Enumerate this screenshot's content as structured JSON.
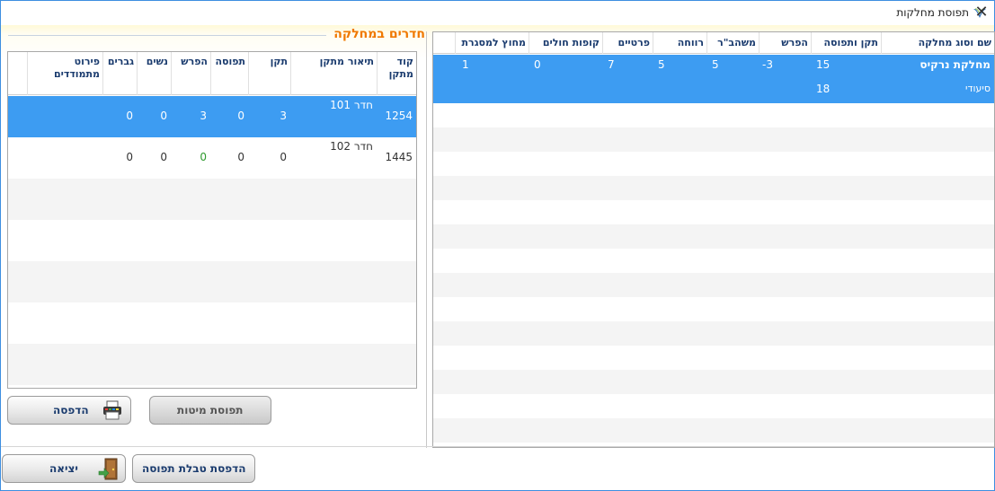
{
  "window": {
    "title": "תפוסת מחלקות",
    "close_glyph": "✕"
  },
  "right_grid": {
    "columns": [
      "שם וסוג מחלקה",
      "תקן ותפוסה",
      "הפרש",
      "משהב\"ר",
      "רווחה",
      "פרטיים",
      "קופות חולים",
      "מחוץ למסגרת"
    ],
    "row": {
      "name": "מחלקת נרקיס",
      "type": "סיעודי",
      "standard": "15",
      "occupancy": "18",
      "difference": "-3",
      "ministry": "5",
      "welfare": "5",
      "private": "7",
      "hmo": "0",
      "outside": "1"
    }
  },
  "left_panel": {
    "title": "חדרים במחלקה",
    "columns": [
      "קוד מתקן",
      "תיאור מתקן",
      "תקן",
      "תפוסה",
      "הפרש",
      "נשים",
      "גברים",
      "פירוט מתמודדים"
    ],
    "rows": [
      {
        "code": "1254",
        "desc": "חדר 101",
        "standard": "3",
        "occupancy": "0",
        "difference": "3",
        "women": "0",
        "men": "0"
      },
      {
        "code": "1445",
        "desc": "חדר 102",
        "standard": "0",
        "occupancy": "0",
        "difference": "0",
        "women": "0",
        "men": "0"
      }
    ]
  },
  "buttons": {
    "print": "הדפסה",
    "bed_occupancy": "תפוסת מיטות",
    "print_occupancy_table": "הדפסת טבלת תפוסה",
    "exit": "יציאה"
  },
  "colors": {
    "selected_row": "#3d9cf2",
    "section_title": "#f07800",
    "header_text": "#1a3b6e",
    "positive_diff": "#2e9a2e"
  }
}
